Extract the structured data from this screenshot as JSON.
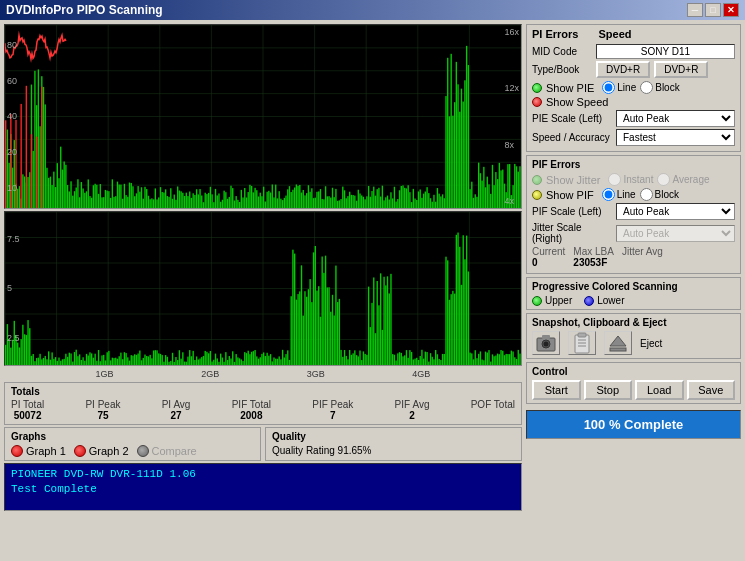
{
  "titleBar": {
    "title": "DVDInfoPro PIPO Scanning",
    "minimizeBtn": "─",
    "maximizeBtn": "□",
    "closeBtn": "✕"
  },
  "piErrors": {
    "sectionLabel": "PI Errors",
    "speedLabel": "Speed",
    "midCodeLabel": "MID Code",
    "midCodeValue": "SONY  D11",
    "typeBookLabel": "Type/Book",
    "typeBook1": "DVD+R",
    "typeBook2": "DVD+R",
    "showPIELabel": "Show PIE",
    "showSpeedLabel": "Show Speed",
    "lineLabel": "Line",
    "blockLabel": "Block",
    "pieScaleLabel": "PIE Scale (Left)",
    "pieScaleValue": "Auto Peak",
    "speedAccuracyLabel": "Speed / Accuracy",
    "speedAccuracyValue": "Fastest"
  },
  "pifErrors": {
    "sectionLabel": "PIF Errors",
    "showJitterLabel": "Show Jitter",
    "instantLabel": "Instant",
    "averageLabel": "Average",
    "showPIFLabel": "Show PIF",
    "lineLabel": "Line",
    "blockLabel": "Block",
    "pifScaleLabel": "PIF Scale (Left)",
    "pifScaleValue": "Auto Peak",
    "jitterScaleLabel": "Jitter Scale (Right)",
    "jitterScaleValue": "Auto Peak",
    "currentLabel": "Current",
    "currentValue": "0",
    "maxLBALabel": "Max LBA",
    "maxLBAValue": "23053F",
    "jitterAvgLabel": "Jitter Avg"
  },
  "progressiveScanning": {
    "sectionLabel": "Progressive Colored Scanning",
    "upperLabel": "Upper",
    "lowerLabel": "Lower"
  },
  "snapshot": {
    "sectionLabel": "Snapshot, Clipboard  & Eject",
    "cameraIcon": "📷",
    "clipboardIcon": "📋",
    "ejectIcon": "⏏"
  },
  "control": {
    "sectionLabel": "Control",
    "startBtn": "Start",
    "stopBtn": "Stop",
    "loadBtn": "Load",
    "saveBtn": "Save"
  },
  "progressBar": {
    "text": "100 % Complete"
  },
  "totals": {
    "title": "Totals",
    "items": [
      {
        "label": "PI Total",
        "value": "50072"
      },
      {
        "label": "PI Peak",
        "value": "75"
      },
      {
        "label": "PI Avg",
        "value": "27"
      },
      {
        "label": "PIF Total",
        "value": "2008"
      },
      {
        "label": "PIF Peak",
        "value": "7"
      },
      {
        "label": "PIF Avg",
        "value": "2"
      },
      {
        "label": "POF Total",
        "value": ""
      }
    ]
  },
  "graphs": {
    "title": "Graphs",
    "graph1Label": "Graph 1",
    "graph2Label": "Graph 2",
    "compareLabel": "Compare"
  },
  "quality": {
    "title": "Quality",
    "ratingLabel": "Quality Rating 91.65%"
  },
  "terminal": {
    "line1": "PIONEER DVD-RW  DVR-111D 1.06",
    "line2": "Test Complete"
  },
  "chartTopYRight": [
    "16x",
    "12x",
    "8x",
    "4x"
  ],
  "chartTopYLeft": [
    "80",
    "60",
    "40",
    "20",
    "10"
  ],
  "chartBottomYLeft": [
    "7.5",
    "5",
    "2.5"
  ],
  "xAxisLabels": [
    "",
    "1GB",
    "2GB",
    "3GB",
    "4GB",
    ""
  ],
  "colors": {
    "chartBg": "#000000",
    "gridLine": "#1a3a1a",
    "pieLine": "#00ff00",
    "pieRedLine": "#ff0000",
    "speedLine": "#ff4444",
    "progressBg": "#1874cd"
  }
}
